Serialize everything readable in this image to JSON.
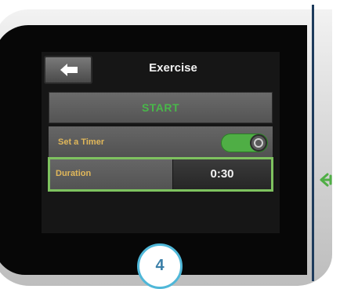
{
  "header": {
    "title": "Exercise",
    "back_icon": "back-arrow-icon"
  },
  "start_button": {
    "label": "START"
  },
  "timer_setting": {
    "label": "Set a Timer",
    "toggle_on": true
  },
  "duration_setting": {
    "label": "Duration",
    "value": "0:30",
    "highlighted": true
  },
  "annotation": {
    "step_number": "4",
    "pointer_icon": "pointer-arrow-icon"
  },
  "colors": {
    "screen_bg": "#161616",
    "start_text": "#49b74a",
    "setting_label": "#e0b75a",
    "toggle_on": "#4fae45",
    "highlight_border": "#7ec25f",
    "badge_border": "#4fb7d8",
    "badge_text": "#3a7fa8"
  }
}
